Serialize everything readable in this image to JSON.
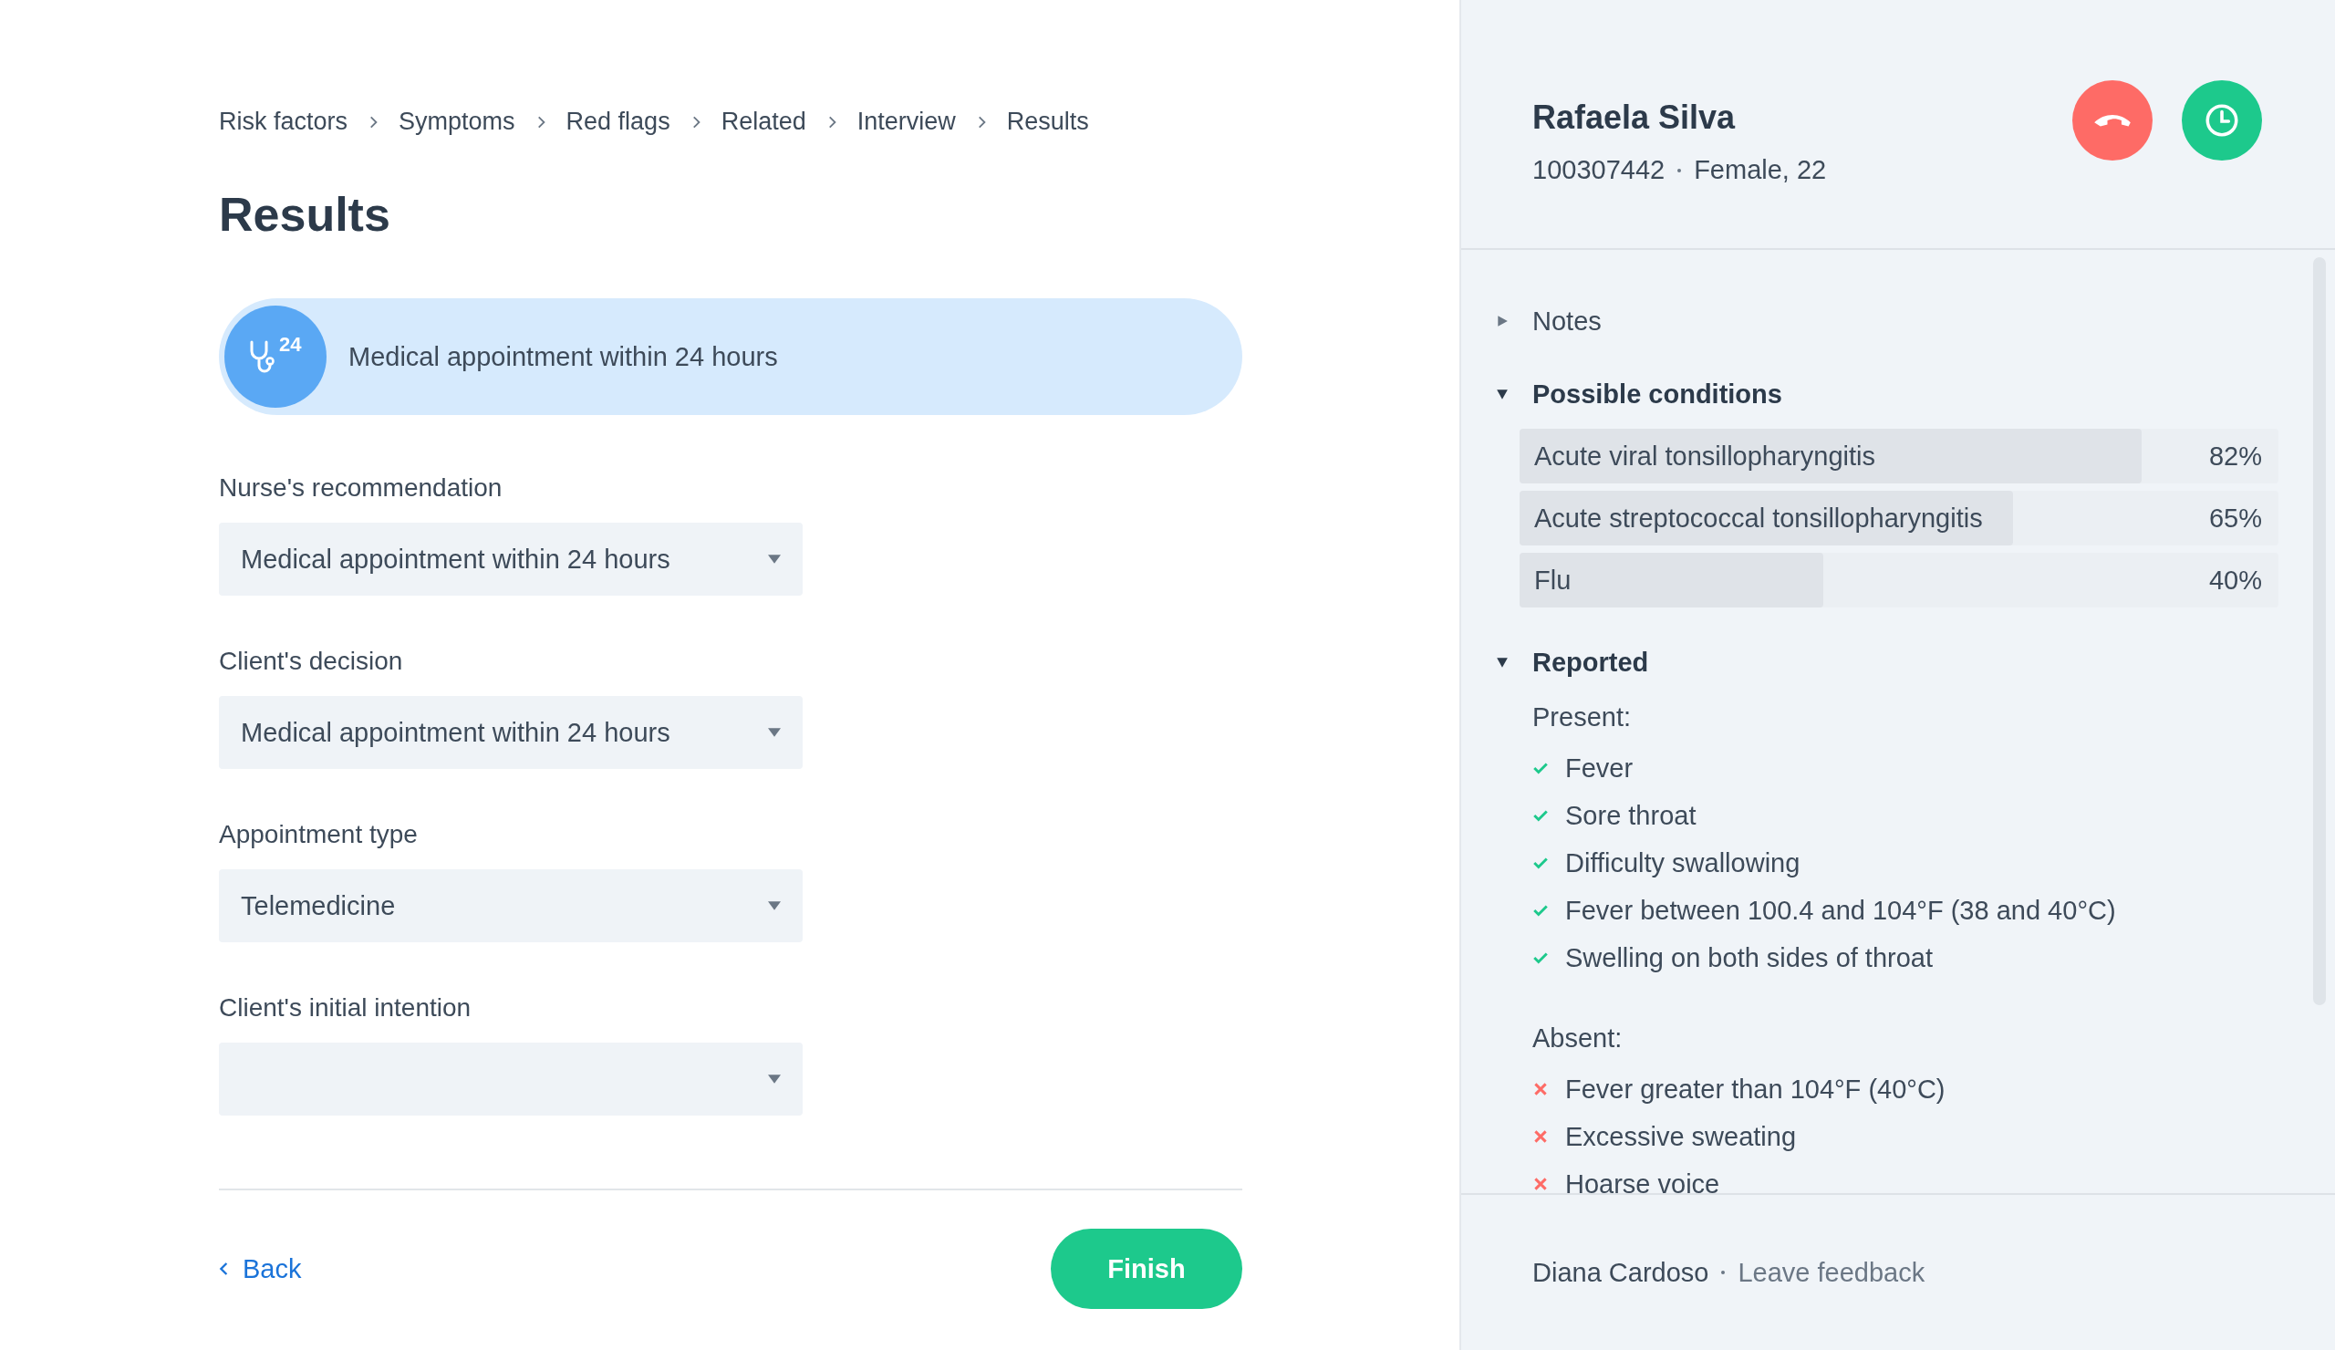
{
  "breadcrumb": [
    "Risk factors",
    "Symptoms",
    "Red flags",
    "Related",
    "Interview",
    "Results"
  ],
  "title": "Results",
  "banner": {
    "icon_label": "24",
    "text": "Medical appointment within 24 hours"
  },
  "fields": [
    {
      "label": "Nurse's recommendation",
      "value": "Medical appointment within 24 hours"
    },
    {
      "label": "Client's decision",
      "value": "Medical appointment within 24 hours"
    },
    {
      "label": "Appointment type",
      "value": "Telemedicine"
    },
    {
      "label": "Client's initial intention"
    }
  ],
  "back": "Back",
  "finish": "Finish",
  "patient": {
    "name": "Rafaela Silva",
    "id": "100307442",
    "details": "Female, 22"
  },
  "notes": {
    "title": "Notes",
    "expanded": false
  },
  "conditions": {
    "title": "Possible conditions",
    "expanded": true,
    "items": [
      {
        "name": "Acute viral tonsillopharyngitis",
        "percent": "82%",
        "level": 0.82
      },
      {
        "name": "Acute streptococcal tonsillopharyngitis",
        "percent": "65%",
        "level": 0.65
      },
      {
        "name": "Flu",
        "percent": "40%",
        "level": 0.4
      }
    ]
  },
  "reported": {
    "title": "Reported",
    "expanded": true,
    "groups": [
      {
        "label": "Present:",
        "kind": "present",
        "items": [
          "Fever",
          "Sore throat",
          "Difficulty swallowing",
          "Fever between 100.4 and 104°F (38 and 40°C)",
          "Swelling on both sides of throat"
        ]
      },
      {
        "label": "Absent:",
        "kind": "absent",
        "items": [
          "Fever greater than 104°F (40°C)",
          "Excessive sweating",
          "Hoarse voice"
        ]
      }
    ]
  },
  "footer": {
    "nurse": "Diana Cardoso",
    "link": "Leave feedback"
  }
}
